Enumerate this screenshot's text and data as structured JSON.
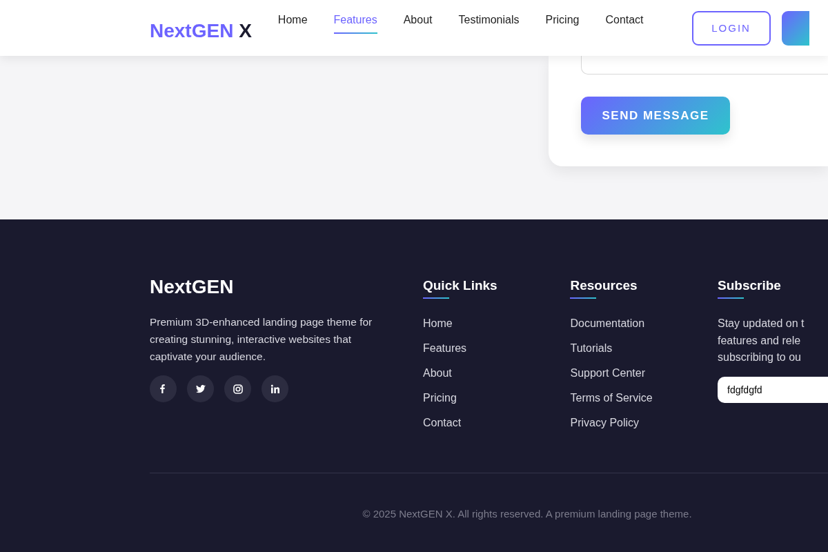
{
  "header": {
    "logo": {
      "main": "NextGEN",
      "accent": "X"
    },
    "nav": [
      {
        "label": "Home",
        "selected": false
      },
      {
        "label": "Features",
        "selected": true
      },
      {
        "label": "About",
        "selected": false
      },
      {
        "label": "Testimonials",
        "selected": false
      },
      {
        "label": "Pricing",
        "selected": false
      },
      {
        "label": "Contact",
        "selected": false
      }
    ],
    "login_button": "LOGIN"
  },
  "contact_form": {
    "submit_button": "SEND MESSAGE"
  },
  "footer": {
    "brand": "NextGEN",
    "description": "Premium 3D-enhanced landing page theme for creating stunning, interactive websites that captivate your audience.",
    "social": [
      {
        "kind": "facebook"
      },
      {
        "kind": "twitter"
      },
      {
        "kind": "instagram"
      },
      {
        "kind": "linkedin"
      }
    ],
    "columns": [
      {
        "title": "Quick Links",
        "links": [
          "Home",
          "Features",
          "About",
          "Pricing",
          "Contact"
        ]
      },
      {
        "title": "Resources",
        "links": [
          "Documentation",
          "Tutorials",
          "Support Center",
          "Terms of Service",
          "Privacy Policy"
        ]
      }
    ],
    "subscribe": {
      "title": "Subscribe",
      "text_lines": [
        "Stay updated on t",
        "features and rele",
        "subscribing to ou"
      ],
      "email_value": "fdgfdgfd"
    },
    "copyright": "© 2025 NextGEN X. All rights reserved. A premium landing page theme."
  }
}
